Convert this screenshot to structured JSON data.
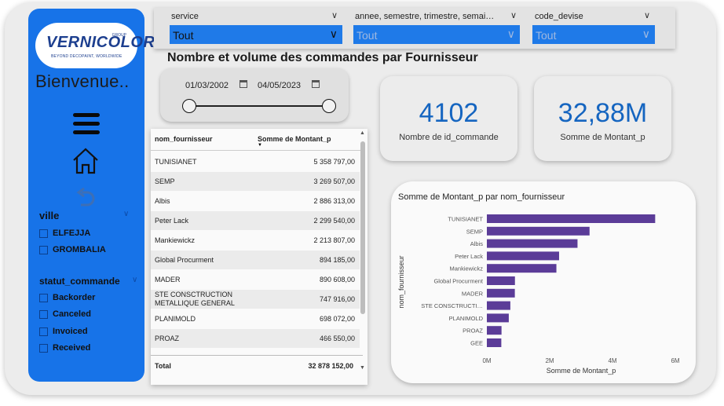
{
  "logo": {
    "main": "VERNICOLOR",
    "group": "GROUP",
    "tagline": "BEYOND DECOPAINT, WORLDWIDE"
  },
  "sidebar": {
    "welcome": "Bienvenue..",
    "icons": [
      "menu-icon",
      "home-icon",
      "back-arrow-icon"
    ],
    "ville": {
      "title": "ville",
      "options": [
        "ELFEJJA",
        "GROMBALIA"
      ]
    },
    "statut": {
      "title": "statut_commande",
      "options": [
        "Backorder",
        "Canceled",
        "Invoiced",
        "Received"
      ]
    }
  },
  "filters": [
    {
      "label": "service",
      "value": "Tout"
    },
    {
      "label": "annee, semestre, trimestre, semai…",
      "value": "Tout"
    },
    {
      "label": "code_devise",
      "value": "Tout"
    }
  ],
  "page_title": "Nombre et volume des commandes par Fournisseur",
  "date_range": {
    "start": "01/03/2002",
    "end": "04/05/2023"
  },
  "table": {
    "headers": [
      "nom_fournisseur",
      "Somme de Montant_p"
    ],
    "rows": [
      [
        "TUNISIANET",
        "5 358 797,00"
      ],
      [
        "SEMP",
        "3 269 507,00"
      ],
      [
        "Albis",
        "2 886 313,00"
      ],
      [
        "Peter Lack",
        "2 299 540,00"
      ],
      [
        "Mankiewickz",
        "2 213 807,00"
      ],
      [
        "Global Procurment",
        "894 185,00"
      ],
      [
        "MADER",
        "890 608,00"
      ],
      [
        "STE CONSCTRUCTION METALLIQUE GENERAL",
        "747 916,00"
      ],
      [
        "PLANIMOLD",
        "698 072,00"
      ],
      [
        "PROAZ",
        "466 550,00"
      ]
    ],
    "total_label": "Total",
    "total_value": "32 878 152,00"
  },
  "kpis": [
    {
      "value": "4102",
      "label": "Nombre de id_commande"
    },
    {
      "value": "32,88M",
      "label": "Somme de Montant_p"
    }
  ],
  "colors": {
    "accent": "#1773e8",
    "bar": "#5b3c98",
    "kpi": "#1565c0"
  },
  "chart_data": {
    "type": "bar",
    "orientation": "horizontal",
    "title": "Somme de Montant_p par nom_fournisseur",
    "xlabel": "Somme de Montant_p",
    "ylabel": "nom_fournisseur",
    "categories": [
      "TUNISIANET",
      "SEMP",
      "Albis",
      "Peter Lack",
      "Mankiewickz",
      "Global Procurment",
      "MADER",
      "STE CONSCTRUCTI…",
      "PLANIMOLD",
      "PROAZ",
      "GEE"
    ],
    "values": [
      5358797,
      3269507,
      2886313,
      2299540,
      2213807,
      894185,
      890608,
      747916,
      698072,
      466550,
      460000
    ],
    "xlim": [
      0,
      6000000
    ],
    "xticks": [
      "0M",
      "2M",
      "4M",
      "6M"
    ],
    "grid": false
  }
}
